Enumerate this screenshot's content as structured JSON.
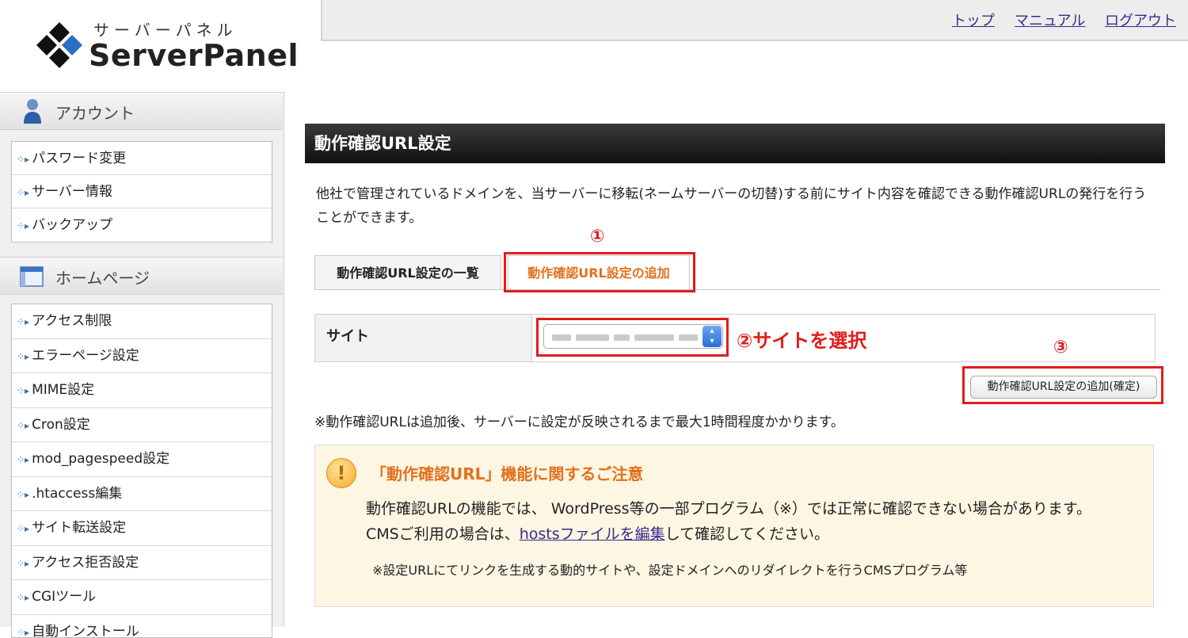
{
  "logo": {
    "kana": "サーバーパネル",
    "text": "ServerPanel"
  },
  "header": {
    "links": [
      "トップ",
      "マニュアル",
      "ログアウト"
    ]
  },
  "sidebar": {
    "sections": [
      {
        "title": "アカウント",
        "items": [
          "パスワード変更",
          "サーバー情報",
          "バックアップ"
        ]
      },
      {
        "title": "ホームページ",
        "items": [
          "アクセス制限",
          "エラーページ設定",
          "MIME設定",
          "Cron設定",
          "mod_pagespeed設定",
          ".htaccess編集",
          "サイト転送設定",
          "アクセス拒否設定",
          "CGIツール",
          "自動インストール"
        ]
      }
    ]
  },
  "main": {
    "title": "動作確認URL設定",
    "description": "他社で管理されているドメインを、当サーバーに移転(ネームサーバーの切替)する前にサイト内容を確認できる動作確認URLの発行を行うことができます。",
    "tabs": [
      {
        "label": "動作確認URL設定の一覧",
        "active": false
      },
      {
        "label": "動作確認URL設定の追加",
        "active": true
      }
    ],
    "form": {
      "site_label": "サイト",
      "confirm_button": "動作確認URL設定の追加(確定)"
    },
    "note": "※動作確認URLは追加後、サーバーに設定が反映されるまで最大1時間程度かかります。",
    "caution": {
      "icon": "!",
      "title": "「動作確認URL」機能に関するご注意",
      "body_before": "動作確認URLの機能では、 WordPress等の一部プログラム（※）では正常に確認できない場合があります。 CMSご利用の場合は、",
      "link": "hostsファイルを編集",
      "body_after": "して確認してください。",
      "footnote": "※設定URLにてリンクを生成する動的サイトや、設定ドメインへのリダイレクトを行うCMSプログラム等"
    }
  },
  "annotations": {
    "step1": "①",
    "step2": "②サイトを選択",
    "step3": "③"
  },
  "colors": {
    "annotation_red": "#e31b1b",
    "active_tab": "#e2711d",
    "link": "#3b2a8a"
  }
}
